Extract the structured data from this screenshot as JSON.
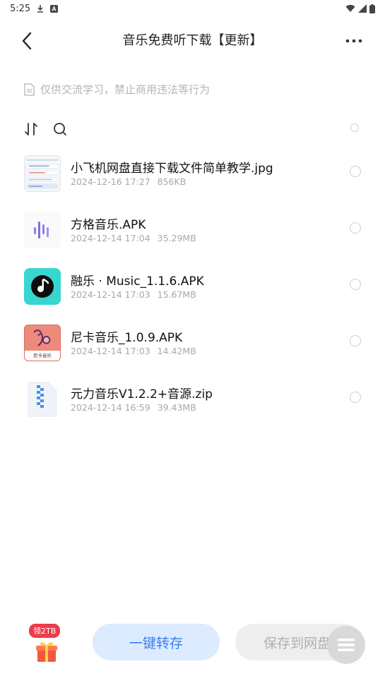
{
  "status_bar": {
    "time": "5:25"
  },
  "header": {
    "title": "音乐免费听下载【更新】"
  },
  "notice": {
    "text": "仅供交流学习，禁止商用违法等行为"
  },
  "files": [
    {
      "name": "小飞机网盘直接下载文件简单教学.jpg",
      "date": "2024-12-16 17:27",
      "size": "856KB",
      "icon": "image-thumbnail"
    },
    {
      "name": "方格音乐.APK",
      "date": "2024-12-14 17:04",
      "size": "35.29MB",
      "icon": "fangge-app-icon"
    },
    {
      "name": "融乐 · Music_1.1.6.APK",
      "date": "2024-12-14 17:03",
      "size": "15.67MB",
      "icon": "music-note-app-icon"
    },
    {
      "name": "尼卡音乐_1.0.9.APK",
      "date": "2024-12-14 17:03",
      "size": "14.42MB",
      "icon": "nika-app-icon",
      "icon_caption": "尼卡音乐"
    },
    {
      "name": "元力音乐V1.2.2+音源.zip",
      "date": "2024-12-14 16:59",
      "size": "39.43MB",
      "icon": "zip-file-icon"
    }
  ],
  "bottom": {
    "gift_badge": "领2TB",
    "transfer_label": "一键转存",
    "save_label": "保存到网盘"
  },
  "colors": {
    "accent": "#3b7cf2",
    "accent_bg": "#dcebff",
    "badge": "#ee3b4a"
  }
}
